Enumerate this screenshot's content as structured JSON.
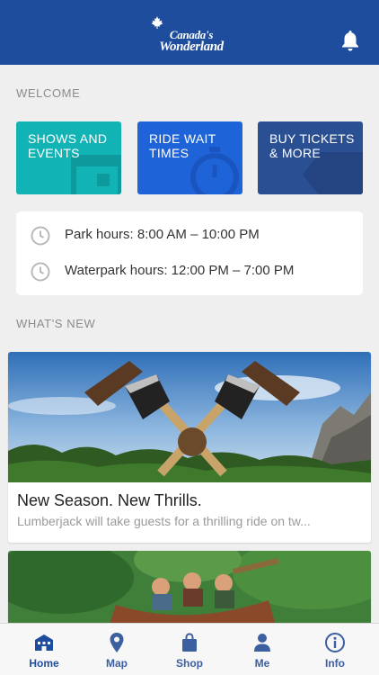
{
  "header": {
    "logo_line1": "Canada's",
    "logo_line2": "Wonderland",
    "notification_icon": "bell-icon"
  },
  "welcome": {
    "section_label": "WELCOME",
    "tiles": [
      {
        "label": "SHOWS AND EVENTS",
        "icon": "calendar-icon",
        "color": "#12b3b5"
      },
      {
        "label": "RIDE WAIT TIMES",
        "icon": "stopwatch-icon",
        "color": "#1e63d8"
      },
      {
        "label": "BUY TICKETS & MORE",
        "icon": "ticket-icon",
        "color": "#2a4f93"
      }
    ]
  },
  "hours": [
    {
      "icon": "clock-icon",
      "text": "Park hours: 8:00 AM – 10:00 PM"
    },
    {
      "icon": "clock-icon",
      "text": "Waterpark hours: 12:00 PM – 7:00 PM"
    }
  ],
  "whats_new": {
    "section_label": "WHAT'S NEW",
    "cards": [
      {
        "title": "New Season. New Thrills.",
        "description": "Lumberjack will take guests for a thrilling ride on tw..."
      },
      {
        "title": "",
        "description": ""
      }
    ]
  },
  "tabbar": {
    "items": [
      {
        "label": "Home",
        "icon": "park-home-icon",
        "active": true
      },
      {
        "label": "Map",
        "icon": "map-pin-icon",
        "active": false
      },
      {
        "label": "Shop",
        "icon": "shopping-bag-icon",
        "active": false
      },
      {
        "label": "Me",
        "icon": "person-icon",
        "active": false
      },
      {
        "label": "Info",
        "icon": "info-icon",
        "active": false
      }
    ]
  },
  "colors": {
    "header": "#1f4d9e",
    "background": "#efefef",
    "tab_accent": "#3c5fa0"
  }
}
